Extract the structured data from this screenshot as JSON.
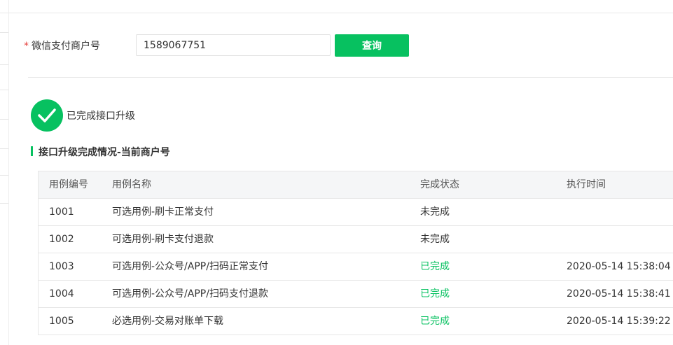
{
  "form": {
    "required_mark": "*",
    "merchant_label": "微信支付商户号",
    "merchant_value": "1589067751",
    "query_button": "查询"
  },
  "status": {
    "icon": "check-circle-icon",
    "text": "已完成接口升级"
  },
  "section": {
    "title": "接口升级完成情况-当前商户号"
  },
  "table": {
    "headers": [
      "用例编号",
      "用例名称",
      "完成状态",
      "执行时间"
    ],
    "rows": [
      {
        "id": "1001",
        "name": "可选用例-刷卡正常支付",
        "status": "未完成",
        "time": ""
      },
      {
        "id": "1002",
        "name": "可选用例-刷卡支付退款",
        "status": "未完成",
        "time": ""
      },
      {
        "id": "1003",
        "name": "可选用例-公众号/APP/扫码正常支付",
        "status": "已完成",
        "time": "2020-05-14 15:38:04"
      },
      {
        "id": "1004",
        "name": "可选用例-公众号/APP/扫码支付退款",
        "status": "已完成",
        "time": "2020-05-14 15:38:41"
      },
      {
        "id": "1005",
        "name": "必选用例-交易对账单下载",
        "status": "已完成",
        "time": "2020-05-14 15:39:22"
      }
    ]
  },
  "colors": {
    "accent": "#07c160",
    "required": "#e64340",
    "header_bg": "#f5f6f7",
    "border": "#e6e6e6"
  }
}
